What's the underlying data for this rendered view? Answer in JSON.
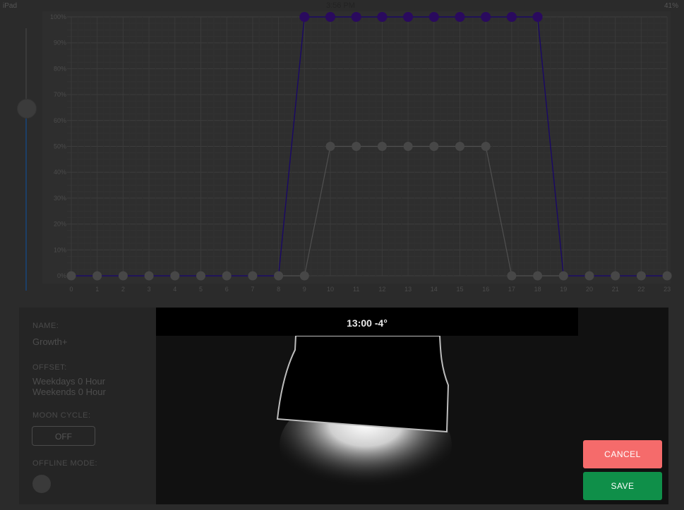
{
  "status_bar": {
    "device": "iPad",
    "time": "3:56 PM",
    "battery": "41%"
  },
  "chart_data": {
    "type": "line",
    "x": [
      0,
      1,
      2,
      3,
      4,
      5,
      6,
      7,
      8,
      9,
      10,
      11,
      12,
      13,
      14,
      15,
      16,
      17,
      18,
      19,
      20,
      21,
      22,
      23
    ],
    "y_ticks": [
      "0%",
      "10%",
      "20%",
      "30%",
      "40%",
      "50%",
      "60%",
      "70%",
      "80%",
      "90%",
      "100%"
    ],
    "ylim": [
      0,
      100
    ],
    "grid": true,
    "series": [
      {
        "color": "#2a0a5e",
        "values": [
          0,
          0,
          0,
          0,
          0,
          0,
          0,
          0,
          0,
          100,
          100,
          100,
          100,
          100,
          100,
          100,
          100,
          100,
          100,
          0,
          0,
          0,
          0,
          0
        ]
      },
      {
        "color": "#4a4a4a",
        "values": [
          0,
          0,
          0,
          0,
          0,
          0,
          0,
          0,
          0,
          0,
          50,
          50,
          50,
          50,
          50,
          50,
          50,
          0,
          0,
          0,
          0,
          0,
          0,
          0
        ]
      }
    ]
  },
  "details": {
    "name_label": "NAME:",
    "name_value": "Growth+",
    "offset_label": "OFFSET:",
    "offset_weekdays": "Weekdays 0 Hour",
    "offset_weekends": "Weekends 0 Hour",
    "moon_label": "MOON CYCLE:",
    "moon_value": "OFF",
    "offline_label": "OFFLINE MODE:"
  },
  "preview": {
    "time_label": "13:00 -4°"
  },
  "actions": {
    "cancel": "CANCEL",
    "save": "SAVE"
  }
}
